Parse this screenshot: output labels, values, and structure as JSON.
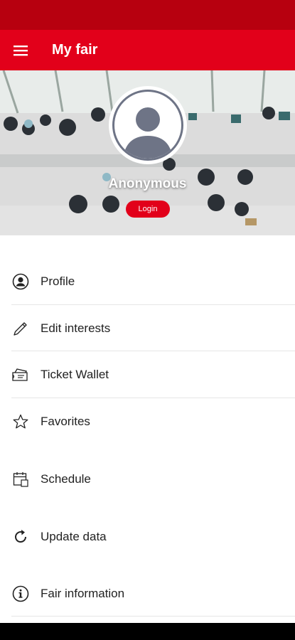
{
  "app_bar": {
    "title": "My fair",
    "menu_icon": "hamburger-menu-icon",
    "background": "#e2001a",
    "status_bar_color": "#b7000f"
  },
  "profile": {
    "name": "Anonymous",
    "login_label": "Login",
    "avatar_icon": "user-avatar-icon"
  },
  "menu": [
    {
      "label": "Profile",
      "icon": "user-circle-icon"
    },
    {
      "label": "Edit interests",
      "icon": "pencil-icon"
    },
    {
      "label": "Ticket Wallet",
      "icon": "ticket-wallet-icon"
    },
    {
      "label": "Favorites",
      "icon": "star-icon"
    },
    {
      "label": "Schedule",
      "icon": "calendar-icon"
    },
    {
      "label": "Update data",
      "icon": "refresh-icon"
    },
    {
      "label": "Fair information",
      "icon": "info-icon"
    }
  ]
}
